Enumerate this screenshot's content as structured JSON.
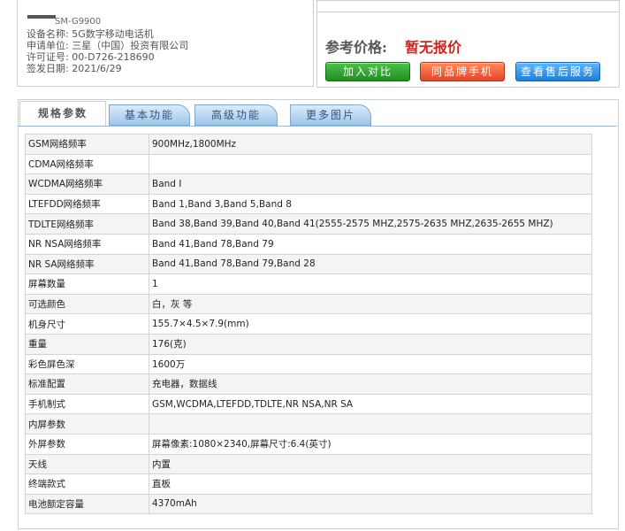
{
  "device": {
    "model": "SM-G9900",
    "name_line": "设备名称: 5G数字移动电话机",
    "applicant_line": "申请单位: 三星（中国）投资有限公司",
    "license_line": "许可证号: 00-D726-218690",
    "date_line": "签发日期: 2021/6/29"
  },
  "price": {
    "label": "参考价格:",
    "value": "暂无报价"
  },
  "buttons": {
    "compare": "加入对比",
    "same_brand": "同品牌手机",
    "after_sales": "查看售后服务"
  },
  "tabs": [
    {
      "label": "规格参数",
      "active": true
    },
    {
      "label": "基本功能",
      "active": false
    },
    {
      "label": "高级功能",
      "active": false
    },
    {
      "label": "更多图片",
      "active": false
    }
  ],
  "specs": [
    {
      "key": "GSM网络频率",
      "value": "900MHz,1800MHz"
    },
    {
      "key": "CDMA网络频率",
      "value": ""
    },
    {
      "key": "WCDMA网络频率",
      "value": "Band Ⅰ"
    },
    {
      "key": "LTEFDD网络频率",
      "value": "Band 1,Band 3,Band 5,Band 8"
    },
    {
      "key": "TDLTE网络频率",
      "value": "Band 38,Band 39,Band 40,Band 41(2555-2575 MHZ,2575-2635 MHZ,2635-2655 MHZ)"
    },
    {
      "key": "NR NSA网络频率",
      "value": "Band 41,Band 78,Band 79"
    },
    {
      "key": "NR SA网络频率",
      "value": "Band 41,Band 78,Band 79,Band 28"
    },
    {
      "key": "屏幕数量",
      "value": "1"
    },
    {
      "key": "可选颜色",
      "value": "白，灰 等"
    },
    {
      "key": "机身尺寸",
      "value": "155.7×4.5×7.9(mm)"
    },
    {
      "key": "重量",
      "value": "176(克)"
    },
    {
      "key": "彩色屏色深",
      "value": "1600万"
    },
    {
      "key": "标准配置",
      "value": "充电器，数据线"
    },
    {
      "key": "手机制式",
      "value": "GSM,WCDMA,LTEFDD,TDLTE,NR NSA,NR SA"
    },
    {
      "key": "内屏参数",
      "value": ""
    },
    {
      "key": "外屏参数",
      "value": "屏幕像素:1080×2340,屏幕尺寸:6.4(英寸)"
    },
    {
      "key": "天线",
      "value": "内置"
    },
    {
      "key": "终端款式",
      "value": "直板"
    },
    {
      "key": "电池额定容量",
      "value": "4370mAh"
    }
  ],
  "colors": {
    "price_red": "#d0241c",
    "btn_green": "#2aa02a",
    "btn_orange": "#e8552f",
    "btn_blue": "#2b8be3"
  }
}
